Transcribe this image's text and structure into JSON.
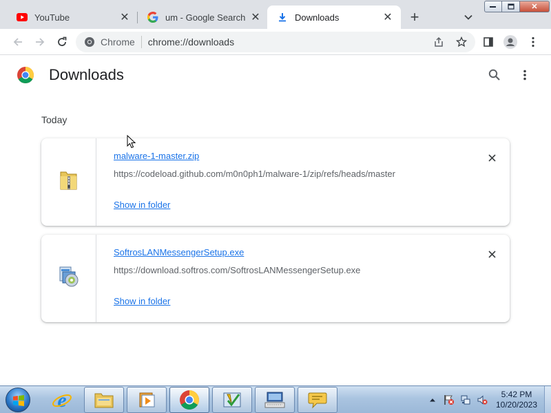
{
  "tabs": [
    {
      "title": "YouTube",
      "icon": "youtube-icon",
      "active": false
    },
    {
      "title": "um - Google Search",
      "icon": "google-icon",
      "active": false
    },
    {
      "title": "Downloads",
      "icon": "download-icon",
      "active": true
    }
  ],
  "omnibox": {
    "chip_label": "Chrome",
    "url": "chrome://downloads"
  },
  "page": {
    "title": "Downloads",
    "section_date": "Today"
  },
  "downloads": [
    {
      "file_name": "malware-1-master.zip",
      "url": "https://codeload.github.com/m0n0ph1/malware-1/zip/refs/heads/master",
      "action": "Show in folder",
      "icon": "zip-folder-icon"
    },
    {
      "file_name": "SoftrosLANMessengerSetup.exe",
      "url": "https://download.softros.com/SoftrosLANMessengerSetup.exe",
      "action": "Show in folder",
      "icon": "installer-icon"
    }
  ],
  "taskbar": {
    "items": [
      "internet-explorer-icon",
      "file-explorer-icon",
      "media-player-icon",
      "chrome-icon",
      "checklist-app-icon",
      "keyboard-app-icon",
      "chat-bubble-app-icon"
    ],
    "clock_time": "5:42 PM",
    "clock_date": "10/20/2023"
  },
  "colors": {
    "link": "#1a73e8",
    "tab_strip": "#dee1e6",
    "taskbar": "#aac4e0"
  }
}
